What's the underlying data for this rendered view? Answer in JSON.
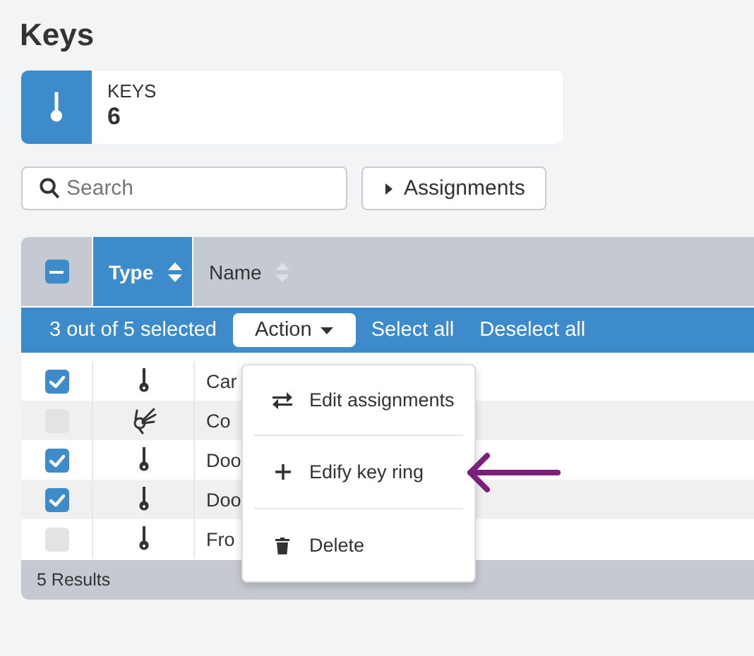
{
  "page": {
    "title": "Keys"
  },
  "stat": {
    "label": "KEYS",
    "value": "6"
  },
  "search": {
    "placeholder": "Search"
  },
  "assignments_button": {
    "label": "Assignments",
    "expanded": false
  },
  "table": {
    "header_checkbox": {
      "indeterminate": true
    },
    "columns": [
      {
        "label": "Type",
        "active": true
      },
      {
        "label": "Name",
        "active": false
      }
    ],
    "selection_bar": {
      "summary": "3 out of 5 selected",
      "action": "Action",
      "links": [
        "Select all",
        "Deselect all"
      ]
    },
    "rows": [
      {
        "kind": "key",
        "name": "Car",
        "checked": true
      },
      {
        "kind": "key-ring",
        "name": "Co",
        "checked": false
      },
      {
        "kind": "key",
        "name": "Doo",
        "checked": true
      },
      {
        "kind": "key",
        "name": "Doo",
        "checked": true
      },
      {
        "kind": "key",
        "name": "Fro",
        "checked": false
      }
    ],
    "footer": "5 Results"
  },
  "menu": {
    "items": [
      {
        "kind": "swap",
        "label": "Edit assignments"
      },
      {
        "kind": "add",
        "label": "Edify key ring"
      },
      {
        "kind": "delete",
        "label": "Delete"
      }
    ]
  }
}
